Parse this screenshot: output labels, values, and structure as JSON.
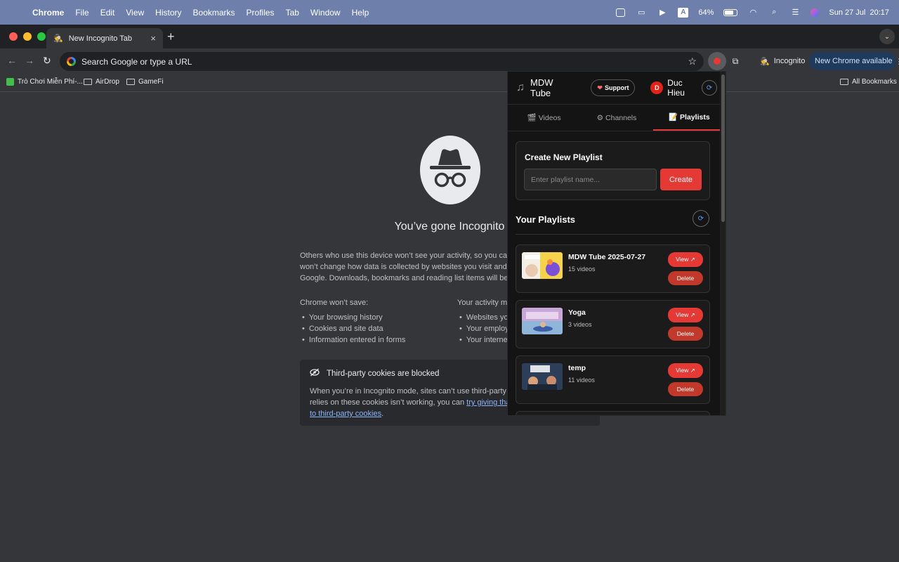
{
  "menubar": {
    "app": "Chrome",
    "menus": [
      "File",
      "Edit",
      "View",
      "History",
      "Bookmarks",
      "Profiles",
      "Tab",
      "Window",
      "Help"
    ],
    "battery": "64%",
    "input_badge": "A",
    "datetime": "Sun 27 Jul  20:17"
  },
  "tab": {
    "title": "New Incognito Tab"
  },
  "omnibox": {
    "placeholder": "Search Google or type a URL"
  },
  "toolbar": {
    "incognito_label": "Incognito",
    "update_label": "New Chrome available"
  },
  "bookmarks": {
    "items": [
      "Trò Chơi Miễn Phí-...",
      "AirDrop",
      "GameFi"
    ],
    "all": "All Bookmarks"
  },
  "incognito": {
    "heading": "You’ve gone Incognito",
    "para": [
      "Others who use this device won’t see your activity, so you can bro",
      "won’t change how data is collected by websites you visit and the se",
      "Google. Downloads, bookmarks and reading list items will be saved."
    ],
    "wont_save_title": "Chrome won’t save:",
    "wont_save": [
      "Your browsing history",
      "Cookies and site data",
      "Information entered in forms"
    ],
    "might_title": "Your activity mig",
    "might": [
      "Websites you",
      "Your employe",
      "Your internet"
    ],
    "cookie_title": "Third-party cookies are blocked",
    "cookie_line1": "When you’re in Incognito mode, sites can’t use third-party coo",
    "cookie_line2_text": "relies on these cookies isn’t working, you can ",
    "cookie_link1": "try giving that s",
    "cookie_link2": "to third-party cookies",
    "cookie_end": "."
  },
  "popup": {
    "title": "MDW Tube",
    "support": "Support",
    "avatar_initial": "D",
    "user": "Duc Hieu",
    "tabs": [
      {
        "icon": "🎬",
        "label": "Videos"
      },
      {
        "icon": "⚙",
        "label": "Channels"
      },
      {
        "icon": "📝",
        "label": "Playlists"
      }
    ],
    "create_title": "Create New Playlist",
    "create_placeholder": "Enter playlist name...",
    "create_btn": "Create",
    "your_playlists": "Your Playlists",
    "view_label": "View ↗",
    "delete_label": "Delete",
    "playlists": [
      {
        "name": "MDW Tube 2025-07-27",
        "count": "15 videos"
      },
      {
        "name": "Yoga",
        "count": "3 videos"
      },
      {
        "name": "temp",
        "count": "11 videos"
      }
    ]
  },
  "colors": {
    "accent": "#e53935",
    "menubar": "#6d7faa",
    "link": "#8ab4f8"
  }
}
